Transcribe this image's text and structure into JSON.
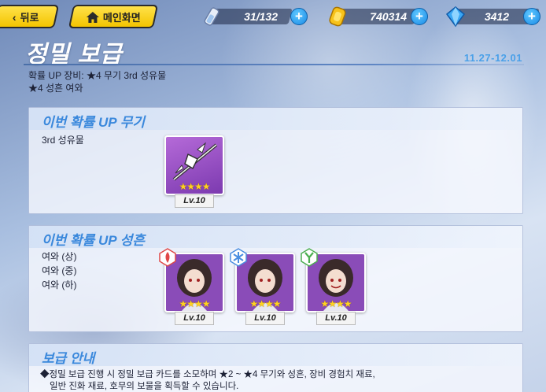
{
  "nav": {
    "back_label": "뒤로",
    "home_label": "메인화면"
  },
  "resources": {
    "stamina": {
      "value": "31/132",
      "icon": "stamina-icon"
    },
    "coins": {
      "value": "740314",
      "icon": "coin-icon"
    },
    "crystals": {
      "value": "3412",
      "icon": "crystal-icon"
    }
  },
  "page": {
    "title": "정밀 보급",
    "date_range": "11.27-12.01",
    "summary_line1": "확률 UP 장비: ★4 무기 3rd 성유물",
    "summary_line2": "★4 성흔 여와"
  },
  "weapon_panel": {
    "title": "이번 확률 UP 무기",
    "item_name": "3rd 성유물",
    "card": {
      "stars": "★★★★",
      "level": "Lv.10"
    }
  },
  "stigmata_panel": {
    "title": "이번 확률 UP 성흔",
    "items": [
      "여와 (상)",
      "여와 (중)",
      "여와 (하)"
    ],
    "cards": [
      {
        "stars": "★★★★",
        "level": "Lv.10",
        "badge": "fire-badge-icon"
      },
      {
        "stars": "★★★★",
        "level": "Lv.10",
        "badge": "ice-badge-icon"
      },
      {
        "stars": "★★★★",
        "level": "Lv.10",
        "badge": "nature-badge-icon"
      }
    ]
  },
  "info_panel": {
    "title": "보급 안내",
    "line1": "◆정밀 보급 진행 시 정밀 보급 카드를 소모하며 ★2 ~ ★4 무기와 성흔, 장비 경험치 재료,",
    "line2": "일반 진화 재료, 호무의 보물을 획득할 수 있습니다."
  },
  "colors": {
    "accent": "#3a88dc",
    "button": "#f3c400",
    "plus": "#1a8ae6"
  }
}
